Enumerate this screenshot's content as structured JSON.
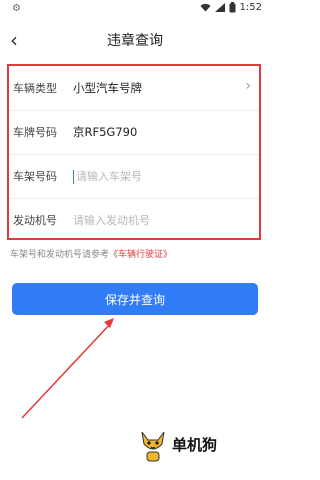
{
  "status": {
    "time": "1:52"
  },
  "nav": {
    "title": "违章查询"
  },
  "form": {
    "vehicle_type": {
      "label": "车辆类型",
      "value": "小型汽车号牌"
    },
    "plate": {
      "label": "车牌号码",
      "value": "京RF5G790"
    },
    "frame": {
      "label": "车架号码",
      "placeholder": "请输入车架号"
    },
    "engine": {
      "label": "发动机号",
      "placeholder": "请输入发动机号"
    }
  },
  "hint": {
    "text": "车架号和发动机号请参考",
    "link": "《车辆行驶证》"
  },
  "save_label": "保存并查询",
  "logo": {
    "text": "单机狗"
  },
  "colors": {
    "accent": "#2f7cf6",
    "highlight": "#e23a3a"
  }
}
